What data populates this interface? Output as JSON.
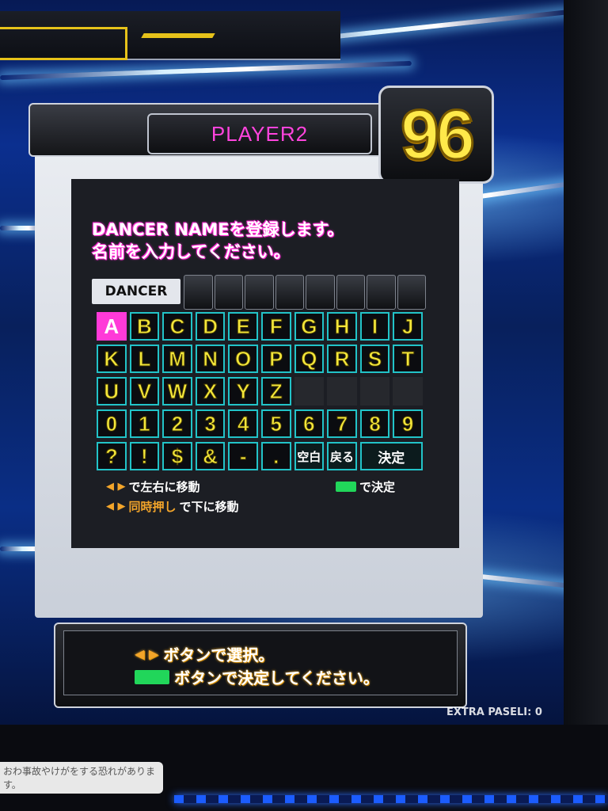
{
  "player": {
    "label": "PLAYER2",
    "score": "96"
  },
  "prompt": {
    "line1": "DANCER NAMEを登録します。",
    "line2": "名前を入力してください。"
  },
  "name_field": {
    "label": "DANCER",
    "slots": 8
  },
  "keyboard": {
    "row1": [
      "A",
      "B",
      "C",
      "D",
      "E",
      "F",
      "G",
      "H",
      "I",
      "J"
    ],
    "row2": [
      "K",
      "L",
      "M",
      "N",
      "O",
      "P",
      "Q",
      "R",
      "S",
      "T"
    ],
    "row3": [
      "U",
      "V",
      "W",
      "X",
      "Y",
      "Z"
    ],
    "row4": [
      "0",
      "1",
      "2",
      "3",
      "4",
      "5",
      "6",
      "7",
      "8",
      "9"
    ],
    "row5": [
      "?",
      "!",
      "$",
      "&",
      "-",
      "."
    ],
    "space_label": "空白",
    "back_label": "戻る",
    "enter_label": "決定",
    "selected": "A"
  },
  "hints": {
    "move_lr": "で左右に移動",
    "confirm": "で決定",
    "simultaneous": "同時押し",
    "move_down": "で下に移動"
  },
  "instructions": {
    "line1": "ボタンで選択。",
    "line2": "ボタンで決定してください。"
  },
  "status": {
    "paseli": "EXTRA PASELI: 0"
  },
  "sticker": {
    "text": "おわ事故やけがをする恐れがあります。"
  },
  "colors": {
    "accent": "#ff44dd",
    "key_text": "#f3e63a",
    "key_border": "#22c3c8",
    "confirm_button": "#21d65a",
    "arrow": "#f3a52a"
  }
}
